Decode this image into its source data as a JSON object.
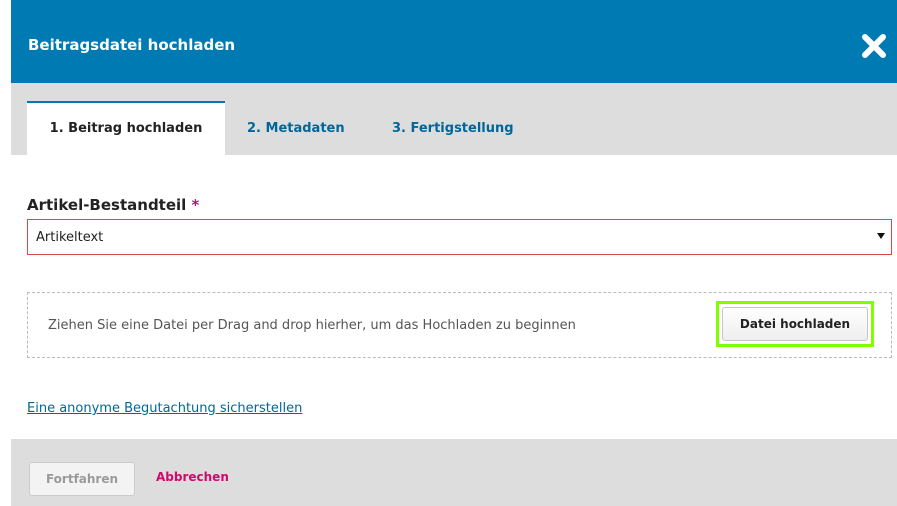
{
  "header": {
    "title": "Beitragsdatei hochladen"
  },
  "tabs": [
    {
      "label": "1. Beitrag hochladen",
      "active": true
    },
    {
      "label": "2. Metadaten",
      "active": false
    },
    {
      "label": "3. Fertigstellung",
      "active": false
    }
  ],
  "form": {
    "component_label": "Artikel-Bestandteil",
    "required_marker": "*",
    "component_value": "Artikeltext"
  },
  "dropzone": {
    "text": "Ziehen Sie eine Datei per Drag and drop hierher, um das Hochladen zu beginnen",
    "upload_label": "Datei hochladen"
  },
  "anonymous_link": "Eine anonyme Begutachtung sicherstellen",
  "footer": {
    "continue_label": "Fortfahren",
    "cancel_label": "Abbrechen"
  },
  "colors": {
    "header_bg": "#007ab2",
    "link": "#006798",
    "required": "#d00a6c",
    "highlight": "#7fff00"
  }
}
